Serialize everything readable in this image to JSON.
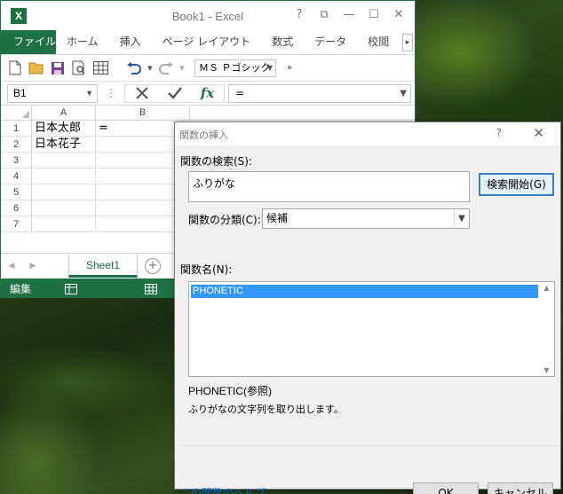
{
  "excel": {
    "logo_letter": "X",
    "title": "Book1 - Excel",
    "window_buttons": [
      "?",
      "⧉",
      "—",
      "☐",
      "✕"
    ],
    "ribbon_tabs": [
      "ファイル",
      "ホーム",
      "挿入",
      "ページ レイアウト",
      "数式",
      "データ",
      "校閲"
    ],
    "ribbon_more": "▸",
    "font_name": "ＭＳ Ｐゴシック",
    "toolbar_more": "»",
    "name_box": "B1",
    "formula_dots": "⋮",
    "fx_label": "fx",
    "formula_value": "=",
    "columns": [
      "A",
      "B"
    ],
    "rows": [
      {
        "num": "1",
        "a": "日本太郎",
        "b": "="
      },
      {
        "num": "2",
        "a": "日本花子",
        "b": ""
      },
      {
        "num": "3",
        "a": "",
        "b": ""
      },
      {
        "num": "4",
        "a": "",
        "b": ""
      },
      {
        "num": "5",
        "a": "",
        "b": ""
      },
      {
        "num": "6",
        "a": "",
        "b": ""
      },
      {
        "num": "7",
        "a": "",
        "b": ""
      }
    ],
    "sheet_nav_prev": "◀",
    "sheet_nav_next": "▶",
    "sheet_tab": "Sheet1",
    "sheet_add": "+",
    "status_mode": "編集"
  },
  "dialog": {
    "title": "関数の挿入",
    "help_icon": "?",
    "close_icon": "✕",
    "search_label": "関数の検索(S):",
    "search_value": "ふりがな",
    "search_button": "検索開始(G)",
    "category_label": "関数の分類(C):",
    "category_value": "候補",
    "function_list_label": "関数名(N):",
    "functions": [
      "PHONETIC"
    ],
    "selected_syntax": "PHONETIC(参照)",
    "selected_description": "ふりがなの文字列を取り出します。",
    "help_link": "この関数のヘルプ",
    "ok_button": "OK",
    "cancel_button": "キャンセル"
  },
  "colors": {
    "excel_green": "#1e7145",
    "selection_blue": "#3399ff",
    "link_blue": "#0066cc"
  }
}
